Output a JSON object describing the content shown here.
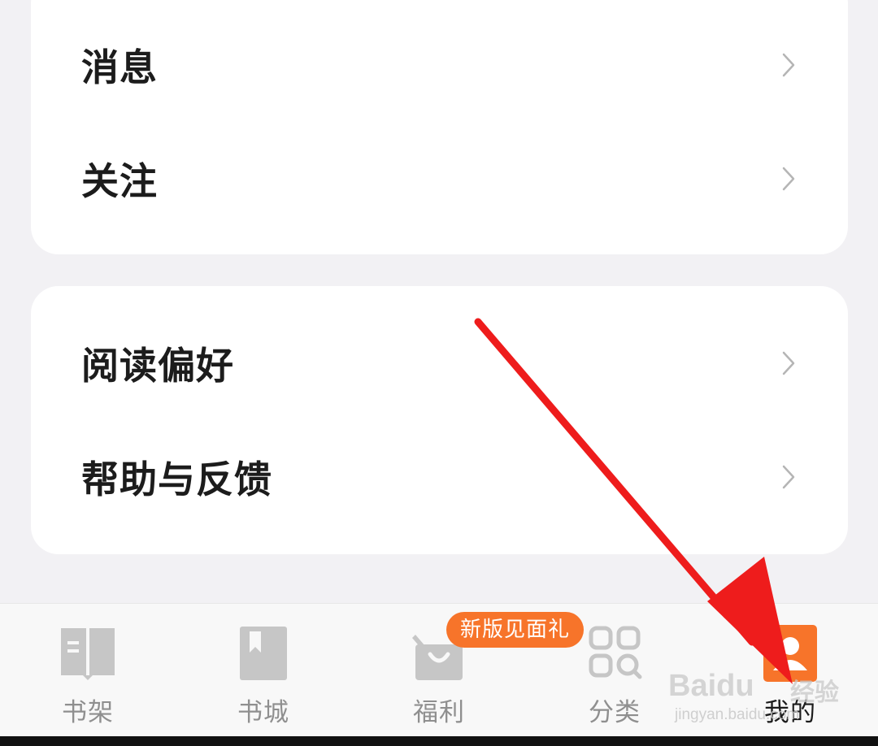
{
  "menu_card_1": {
    "items": [
      {
        "label": "消息"
      },
      {
        "label": "关注"
      }
    ]
  },
  "menu_card_2": {
    "items": [
      {
        "label": "阅读偏好"
      },
      {
        "label": "帮助与反馈"
      }
    ]
  },
  "tabbar": {
    "tabs": [
      {
        "label": "书架",
        "icon": "bookshelf-icon",
        "active": false
      },
      {
        "label": "书城",
        "icon": "bookstore-icon",
        "active": false
      },
      {
        "label": "福利",
        "icon": "gift-icon",
        "active": false
      },
      {
        "label": "分类",
        "icon": "category-icon",
        "active": false
      },
      {
        "label": "我的",
        "icon": "profile-icon",
        "active": true
      }
    ],
    "badge": "新版见面礼"
  },
  "colors": {
    "accent": "#f7742a",
    "annotation_arrow": "#ee1c1c",
    "inactive_icon": "#c6c6c6",
    "background": "#f2f1f4"
  },
  "watermark": {
    "brand": "Baidu",
    "sub": "经验",
    "url": "jingyan.baidu.com"
  }
}
